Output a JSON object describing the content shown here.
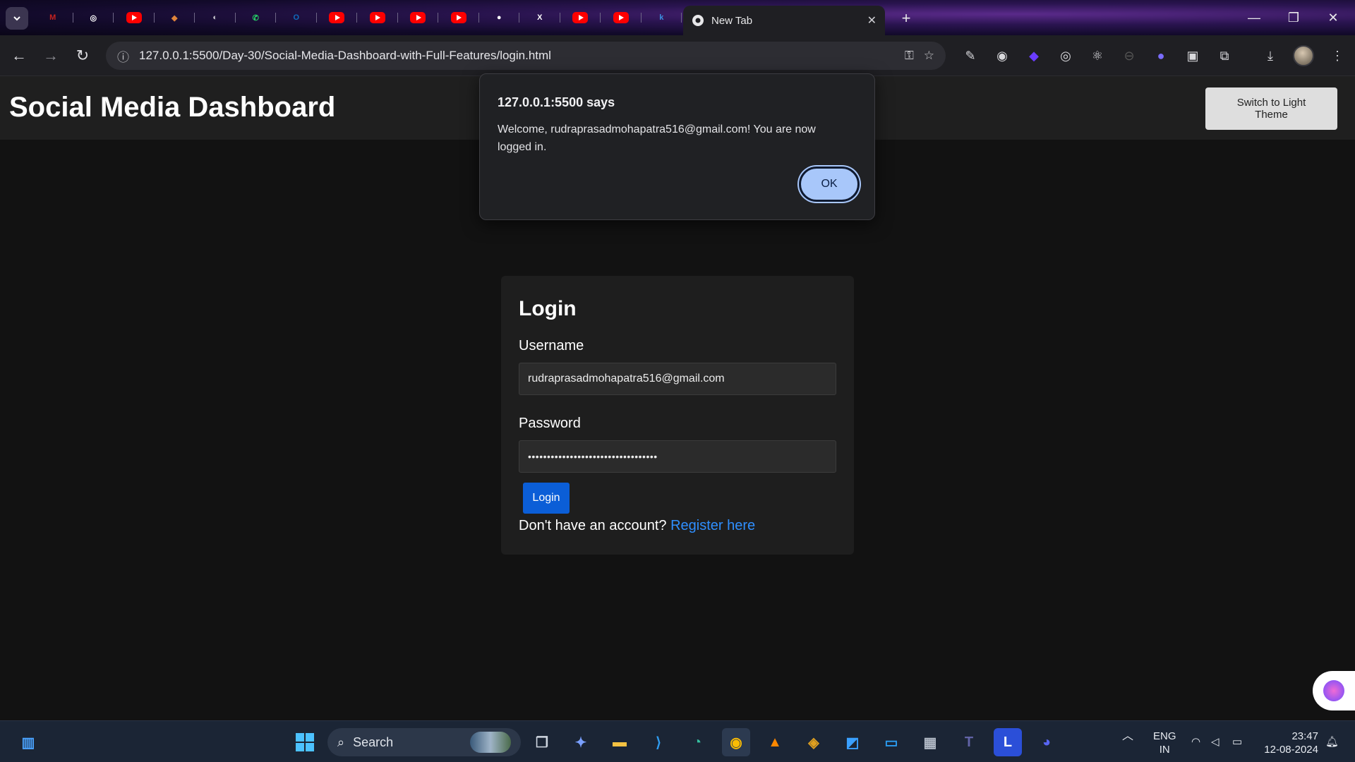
{
  "browser": {
    "active_tab_title": "New Tab",
    "url": "127.0.0.1:5500/Day-30/Social-Media-Dashboard-with-Full-Features/login.html",
    "pinned_tabs": [
      {
        "icon": "gmail-icon",
        "glyph": "M",
        "color": "#c5221f"
      },
      {
        "icon": "chatgpt-icon",
        "glyph": "◎",
        "color": "#ffffff"
      },
      {
        "icon": "youtube-icon",
        "glyph": "",
        "color": "#ff0000"
      },
      {
        "icon": "codepen-icon",
        "glyph": "◆",
        "color": "#e0833a"
      },
      {
        "icon": "globe-icon",
        "glyph": "◐",
        "color": "#cfcfd4"
      },
      {
        "icon": "whatsapp-icon",
        "glyph": "✆",
        "color": "#25d366"
      },
      {
        "icon": "outlook-icon",
        "glyph": "O",
        "color": "#0f6cbd"
      },
      {
        "icon": "youtube-icon",
        "glyph": "",
        "color": "#ff0000"
      },
      {
        "icon": "youtube-icon",
        "glyph": "",
        "color": "#ff0000"
      },
      {
        "icon": "youtube-icon",
        "glyph": "",
        "color": "#ff0000"
      },
      {
        "icon": "youtube-icon",
        "glyph": "",
        "color": "#ff0000"
      },
      {
        "icon": "github-icon",
        "glyph": "●",
        "color": "#ffffff"
      },
      {
        "icon": "x-icon",
        "glyph": "X",
        "color": "#ffffff"
      },
      {
        "icon": "youtube-icon",
        "glyph": "",
        "color": "#ff0000"
      },
      {
        "icon": "youtube-icon",
        "glyph": "",
        "color": "#ff0000"
      },
      {
        "icon": "kimi-icon",
        "glyph": "k",
        "color": "#3b8fe0"
      }
    ]
  },
  "page": {
    "title": "Social Media Dashboard",
    "theme_button": "Switch to Light Theme"
  },
  "login": {
    "heading": "Login",
    "username_label": "Username",
    "username_value": "rudraprasadmohapatra516@gmail.com",
    "password_label": "Password",
    "password_value": "••••••••••••••••••••••••••••••••••",
    "submit_label": "Login",
    "register_prompt": "Don't have an account?",
    "register_link": "Register here"
  },
  "dialog": {
    "title": "127.0.0.1:5500 says",
    "message": "Welcome, rudraprasadmohapatra516@gmail.com! You are now logged in.",
    "ok_label": "OK"
  },
  "taskbar": {
    "search_label": "Search",
    "language": "ENG",
    "region": "IN",
    "time": "23:47",
    "date": "12-08-2024"
  },
  "colors": {
    "accent_blue": "#0b5ed7",
    "link_blue": "#2f8fff",
    "dialog_ok": "#a8c7fa"
  }
}
